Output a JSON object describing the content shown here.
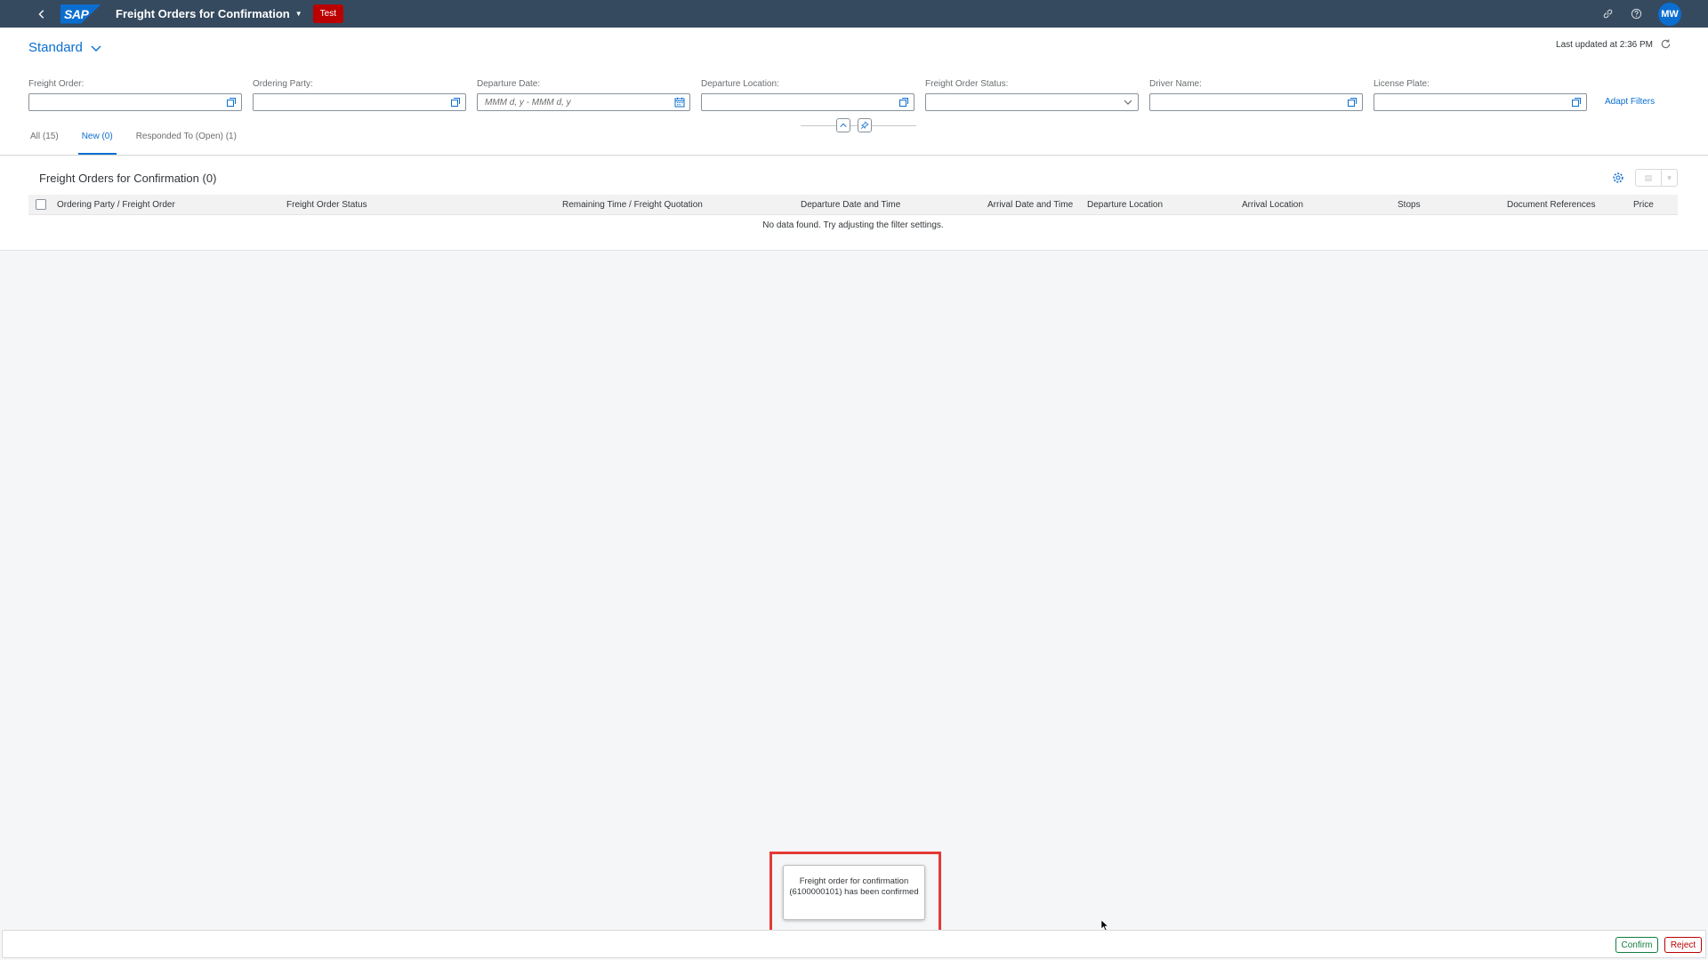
{
  "shell": {
    "logo_text": "SAP",
    "app_title": "Freight Orders for Confirmation",
    "env_badge": "Test",
    "user_initials": "MW",
    "icons": [
      "back-icon",
      "link-icon",
      "help-icon"
    ]
  },
  "header": {
    "variant": "Standard",
    "last_updated": "Last updated at 2:36 PM"
  },
  "filters": [
    {
      "label": "Freight Order:",
      "placeholder": "",
      "icon": "value-help-icon"
    },
    {
      "label": "Ordering Party:",
      "placeholder": "",
      "icon": "value-help-icon"
    },
    {
      "label": "Departure Date:",
      "placeholder": "MMM d, y - MMM d, y",
      "icon": "calendar-icon"
    },
    {
      "label": "Departure Location:",
      "placeholder": "",
      "icon": "value-help-icon"
    },
    {
      "label": "Freight Order Status:",
      "placeholder": "",
      "icon": "dropdown-icon"
    },
    {
      "label": "Driver Name:",
      "placeholder": "",
      "icon": "value-help-icon"
    },
    {
      "label": "License Plate:",
      "placeholder": "",
      "icon": "value-help-icon"
    }
  ],
  "adapt_filters": "Adapt Filters",
  "tabs": [
    {
      "label": "All (15)",
      "active": false
    },
    {
      "label": "New (0)",
      "active": true
    },
    {
      "label": "Responded To (Open) (1)",
      "active": false
    }
  ],
  "table": {
    "title": "Freight Orders for Confirmation (0)",
    "columns": [
      "Ordering Party / Freight Order",
      "Freight Order Status",
      "Remaining Time / Freight Quotation",
      "Departure Date and Time",
      "Arrival Date and Time",
      "Departure Location",
      "Arrival Location",
      "Stops",
      "Document References",
      "Price"
    ],
    "no_data": "No data found. Try adjusting the filter settings."
  },
  "toast": {
    "message": "Freight order for confirmation (6100000101) has been confirmed"
  },
  "footer": {
    "confirm_label": "Confirm",
    "reject_label": "Reject"
  },
  "colors": {
    "shell_bg": "#354a5f",
    "accent": "#0a6ed1",
    "badge": "#bb0000",
    "confirm": "#107e3e",
    "reject": "#bb0000",
    "highlight": "#e53935"
  }
}
